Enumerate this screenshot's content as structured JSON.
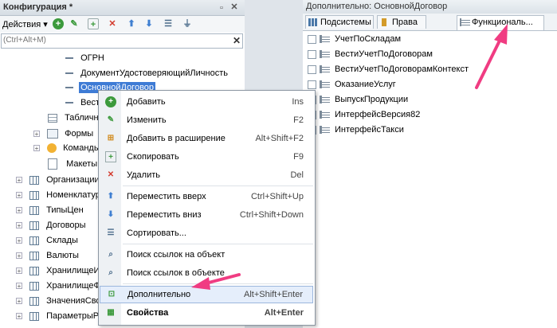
{
  "left_panel": {
    "title": "Конфигурация *",
    "actions_label": "Действия",
    "search_placeholder": "(Ctrl+Alt+M)",
    "tree": [
      {
        "label": "ОГРН",
        "icon": "attribute-icon",
        "indent": 3
      },
      {
        "label": "ДокументУдостоверяющийЛичность",
        "icon": "attribute-icon",
        "indent": 3
      },
      {
        "label": "ОсновнойДоговор",
        "icon": "attribute-icon",
        "indent": 3,
        "selected": true
      },
      {
        "label": "Вести",
        "icon": "attribute-icon",
        "indent": 3
      },
      {
        "label": "Табличн",
        "icon": "tabular-icon",
        "indent": 2
      },
      {
        "label": "Формы",
        "icon": "forms-icon",
        "indent": 2,
        "expandable": true
      },
      {
        "label": "Команды",
        "icon": "commands-icon",
        "indent": 2,
        "expandable": true
      },
      {
        "label": "Макеты",
        "icon": "templates-icon",
        "indent": 2
      },
      {
        "label": "Организации",
        "icon": "catalog-icon",
        "indent": 1,
        "expandable": true
      },
      {
        "label": "Номенклатура",
        "icon": "catalog-icon",
        "indent": 1,
        "expandable": true
      },
      {
        "label": "ТипыЦен",
        "icon": "catalog-icon",
        "indent": 1,
        "expandable": true
      },
      {
        "label": "Договоры",
        "icon": "catalog-icon",
        "indent": 1,
        "expandable": true
      },
      {
        "label": "Склады",
        "icon": "catalog-icon",
        "indent": 1,
        "expandable": true
      },
      {
        "label": "Валюты",
        "icon": "catalog-icon",
        "indent": 1,
        "expandable": true
      },
      {
        "label": "ХранилищеИ",
        "icon": "catalog-icon",
        "indent": 1,
        "expandable": true
      },
      {
        "label": "ХранилищеФ",
        "icon": "catalog-icon",
        "indent": 1,
        "expandable": true
      },
      {
        "label": "ЗначенияСвой",
        "icon": "catalog-icon",
        "indent": 1,
        "expandable": true
      },
      {
        "label": "ПараметрыР",
        "icon": "catalog-icon",
        "indent": 1,
        "expandable": true
      }
    ]
  },
  "right_panel": {
    "title": "Дополнительно: ОсновнойДоговор",
    "tabs": [
      "Подсистемы",
      "Права",
      "Функциональ..."
    ],
    "items": [
      "УчетПоСкладам",
      "ВестиУчетПоДоговорам",
      "ВестиУчетПоДоговорамКонтекст",
      "ОказаниеУслуг",
      "ВыпускПродукции",
      "ИнтерфейсВерсия82",
      "ИнтерфейсТакси"
    ]
  },
  "context_menu": {
    "items": [
      {
        "label": "Добавить",
        "shortcut": "Ins",
        "icon": "add-icon",
        "color": "#3c9a3c"
      },
      {
        "label": "Изменить",
        "shortcut": "F2",
        "icon": "pencil-icon",
        "color": "#3c9a3c"
      },
      {
        "label": "Добавить в расширение",
        "shortcut": "Alt+Shift+F2",
        "icon": "add-extension-icon",
        "color": "#d18a1c"
      },
      {
        "label": "Скопировать",
        "shortcut": "F9",
        "icon": "copy-icon",
        "color": "#3c9a3c"
      },
      {
        "label": "Удалить",
        "shortcut": "Del",
        "icon": "delete-icon",
        "color": "#d33a2c"
      },
      {
        "label": "Переместить вверх",
        "shortcut": "Ctrl+Shift+Up",
        "icon": "arrow-up-icon",
        "color": "#3f7fd1"
      },
      {
        "label": "Переместить вниз",
        "shortcut": "Ctrl+Shift+Down",
        "icon": "arrow-down-icon",
        "color": "#3f7fd1"
      },
      {
        "label": "Сортировать...",
        "shortcut": "",
        "icon": "sort-icon",
        "color": "#4a6b8a"
      },
      {
        "label": "Поиск ссылок на объект",
        "shortcut": "",
        "icon": "find-references-icon",
        "color": "#4a6b8a"
      },
      {
        "label": "Поиск ссылок в объекте",
        "shortcut": "",
        "icon": "find-in-object-icon",
        "color": "#4a6b8a"
      },
      {
        "label": "Дополнительно",
        "shortcut": "Alt+Shift+Enter",
        "icon": "additional-icon",
        "color": "#3c9a3c",
        "highlighted": true
      },
      {
        "label": "Свойства",
        "shortcut": "Alt+Enter",
        "icon": "properties-icon",
        "color": "#3c9a3c",
        "bold": true
      }
    ]
  },
  "colors": {
    "arrow": "#f03c82",
    "selection": "#3e7bd5"
  }
}
